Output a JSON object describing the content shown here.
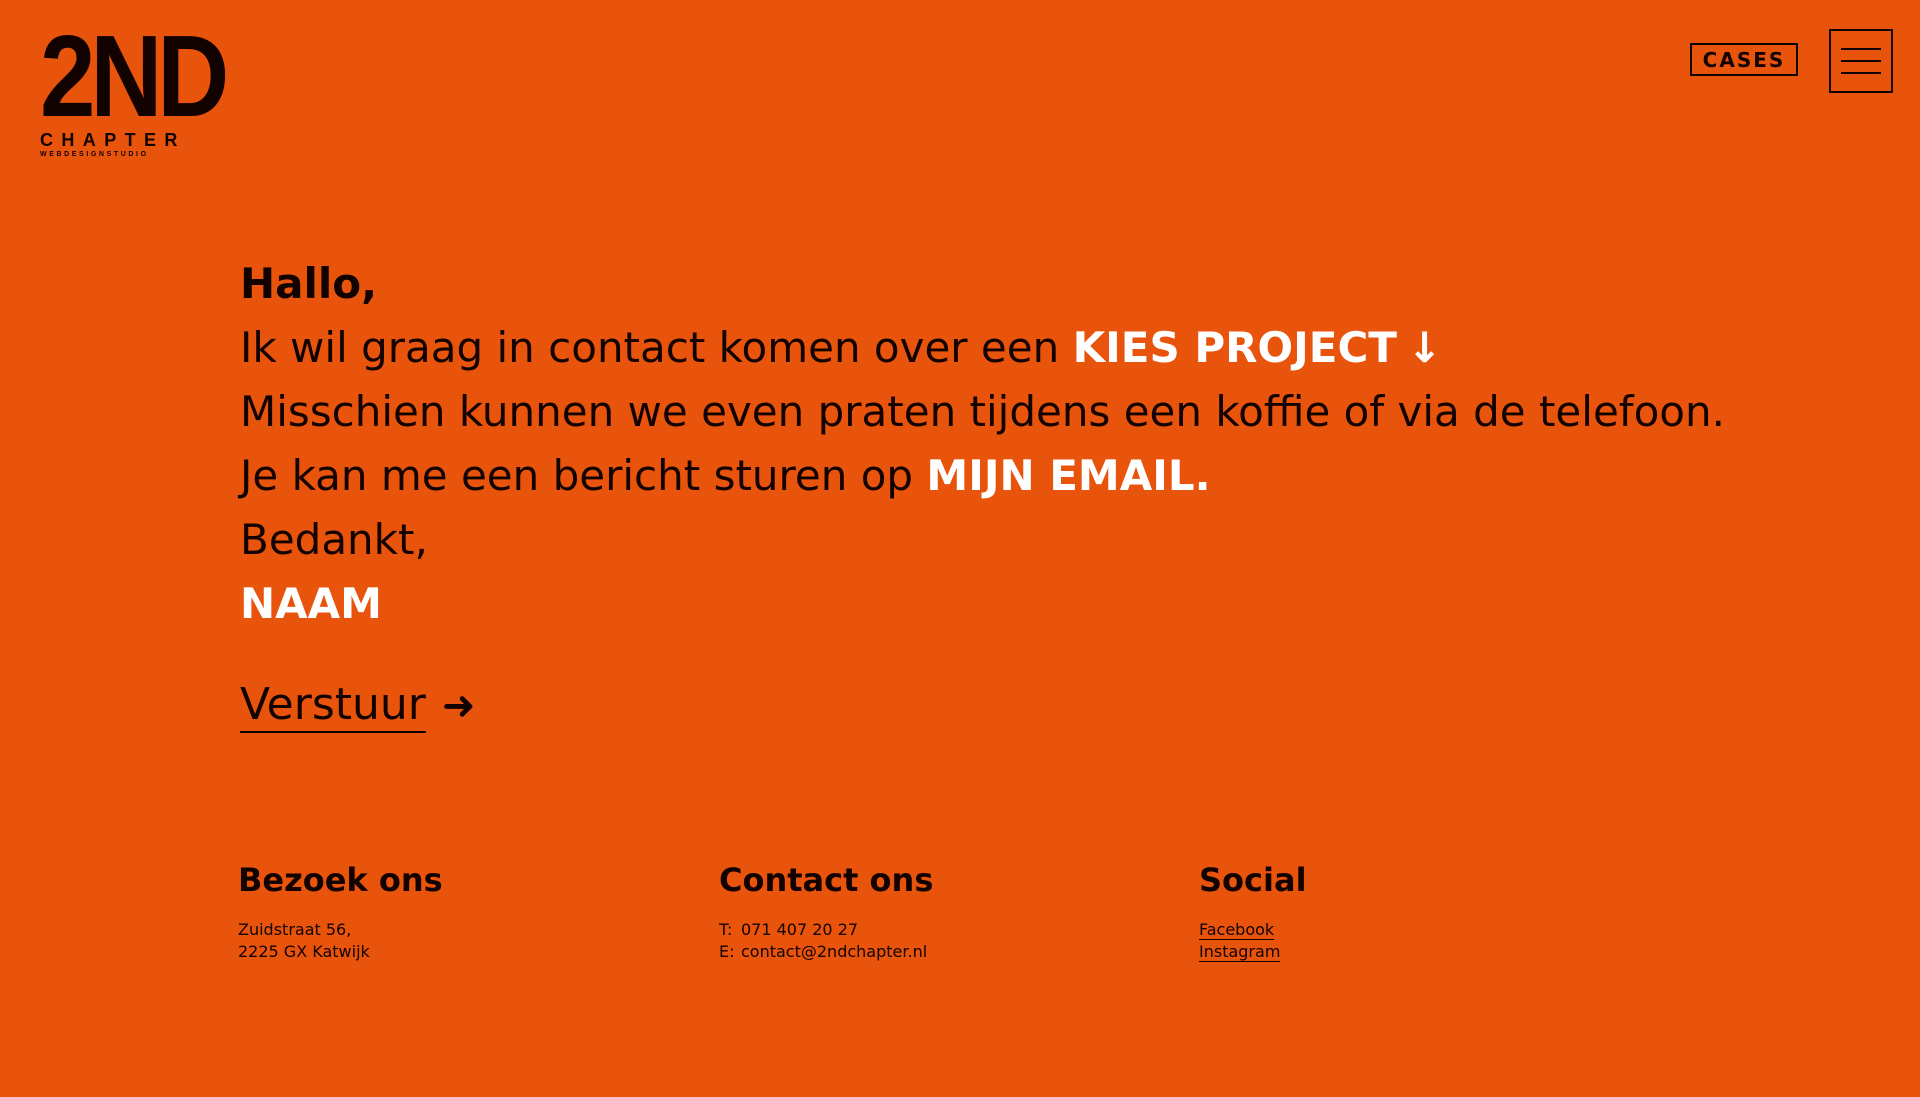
{
  "header": {
    "logo": {
      "mark": "2ND",
      "sub": "CHAPTER",
      "tagline": "WEBDESIGNSTUDIO"
    },
    "cases_label": "CASES",
    "menu_icon": "hamburger-icon"
  },
  "letter": {
    "greeting": "Hallo,",
    "line1_prefix": "Ik wil graag in contact komen over een ",
    "project_field": "KIES PROJECT",
    "project_arrow": "↓",
    "line2": "Misschien kunnen we even praten tijdens een koffie of via de telefoon.",
    "line3_prefix": "Je kan me een bericht sturen op ",
    "email_field": "MIJN EMAIL.",
    "thanks": "Bedankt,",
    "name_field": "NAAM"
  },
  "send": {
    "label": "Verstuur",
    "arrow": "➜"
  },
  "footer": {
    "visit": {
      "title": "Bezoek ons",
      "address_line1": "Zuidstraat 56,",
      "address_line2": "2225 GX Katwijk"
    },
    "contact": {
      "title": "Contact ons",
      "phone_prefix": "T:",
      "phone": "071 407 20 27",
      "email_prefix": "E:",
      "email": "contact@2ndchapter.nl"
    },
    "social": {
      "title": "Social",
      "links": [
        "Facebook",
        "Instagram"
      ]
    }
  },
  "colors": {
    "background": "#e9540d",
    "text": "#120200",
    "field": "#ffffff"
  }
}
